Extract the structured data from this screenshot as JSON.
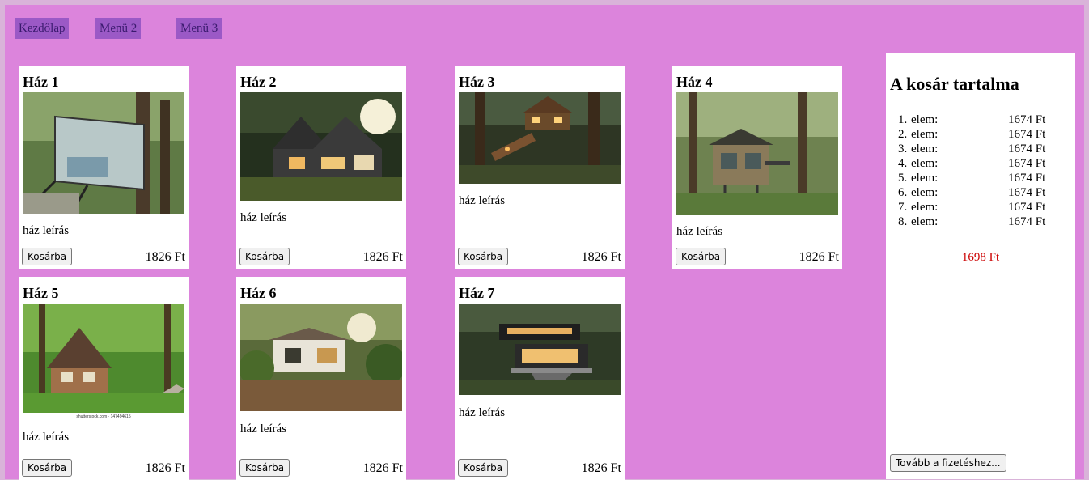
{
  "nav": {
    "items": [
      {
        "label": "Kezdőlap"
      },
      {
        "label": "Menü 2"
      },
      {
        "label": "Menü 3"
      }
    ]
  },
  "products": [
    {
      "title": "Ház 1",
      "desc": "ház leírás",
      "button": "Kosárba",
      "price": "1826 Ft"
    },
    {
      "title": "Ház 2",
      "desc": "ház leírás",
      "button": "Kosárba",
      "price": "1826 Ft"
    },
    {
      "title": "Ház 3",
      "desc": "ház leírás",
      "button": "Kosárba",
      "price": "1826 Ft"
    },
    {
      "title": "Ház 4",
      "desc": "ház leírás",
      "button": "Kosárba",
      "price": "1826 Ft"
    },
    {
      "title": "Ház 5",
      "desc": "ház leírás",
      "button": "Kosárba",
      "price": "1826 Ft",
      "image_caption": "shutterstock.com · 147494615"
    },
    {
      "title": "Ház 6",
      "desc": "ház leírás",
      "button": "Kosárba",
      "price": "1826 Ft"
    },
    {
      "title": "Ház 7",
      "desc": "ház leírás",
      "button": "Kosárba",
      "price": "1826 Ft"
    }
  ],
  "cart": {
    "title": "A kosár tartalma",
    "items": [
      {
        "num": "1.",
        "label": "elem:",
        "price": "1674 Ft"
      },
      {
        "num": "2.",
        "label": "elem:",
        "price": "1674 Ft"
      },
      {
        "num": "3.",
        "label": "elem:",
        "price": "1674 Ft"
      },
      {
        "num": "4.",
        "label": "elem:",
        "price": "1674 Ft"
      },
      {
        "num": "5.",
        "label": "elem:",
        "price": "1674 Ft"
      },
      {
        "num": "6.",
        "label": "elem:",
        "price": "1674 Ft"
      },
      {
        "num": "7.",
        "label": "elem:",
        "price": "1674 Ft"
      },
      {
        "num": "8.",
        "label": "elem:",
        "price": "1674 Ft"
      }
    ],
    "total": "1698 Ft",
    "checkout_label": "Tovább a fizetéshez..."
  },
  "colors": {
    "page_bg": "#dc84dc",
    "nav_bg": "#9b59c6",
    "nav_text": "#3a1a6e",
    "total_text": "#cc0000"
  }
}
